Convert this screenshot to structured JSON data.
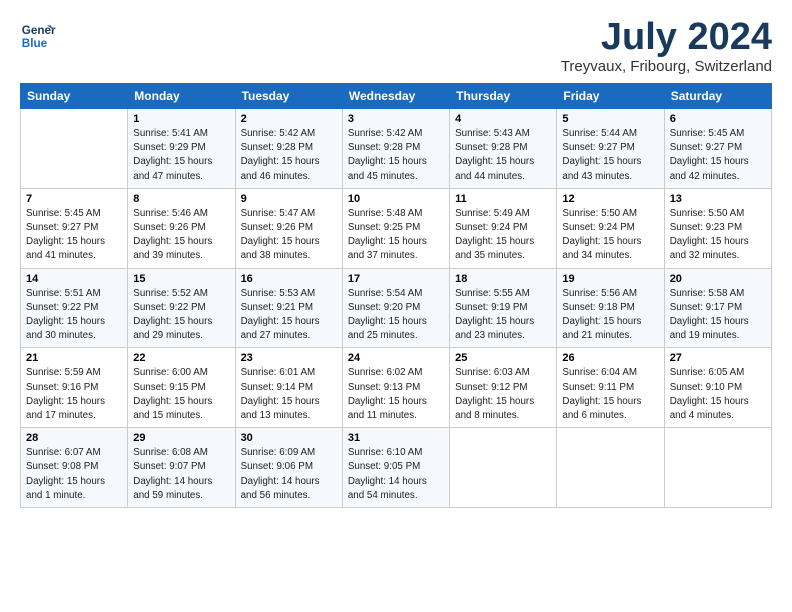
{
  "header": {
    "logo_line1": "General",
    "logo_line2": "Blue",
    "month": "July 2024",
    "location": "Treyvaux, Fribourg, Switzerland"
  },
  "weekdays": [
    "Sunday",
    "Monday",
    "Tuesday",
    "Wednesday",
    "Thursday",
    "Friday",
    "Saturday"
  ],
  "weeks": [
    [
      {
        "day": "",
        "content": ""
      },
      {
        "day": "1",
        "content": "Sunrise: 5:41 AM\nSunset: 9:29 PM\nDaylight: 15 hours\nand 47 minutes."
      },
      {
        "day": "2",
        "content": "Sunrise: 5:42 AM\nSunset: 9:28 PM\nDaylight: 15 hours\nand 46 minutes."
      },
      {
        "day": "3",
        "content": "Sunrise: 5:42 AM\nSunset: 9:28 PM\nDaylight: 15 hours\nand 45 minutes."
      },
      {
        "day": "4",
        "content": "Sunrise: 5:43 AM\nSunset: 9:28 PM\nDaylight: 15 hours\nand 44 minutes."
      },
      {
        "day": "5",
        "content": "Sunrise: 5:44 AM\nSunset: 9:27 PM\nDaylight: 15 hours\nand 43 minutes."
      },
      {
        "day": "6",
        "content": "Sunrise: 5:45 AM\nSunset: 9:27 PM\nDaylight: 15 hours\nand 42 minutes."
      }
    ],
    [
      {
        "day": "7",
        "content": "Sunrise: 5:45 AM\nSunset: 9:27 PM\nDaylight: 15 hours\nand 41 minutes."
      },
      {
        "day": "8",
        "content": "Sunrise: 5:46 AM\nSunset: 9:26 PM\nDaylight: 15 hours\nand 39 minutes."
      },
      {
        "day": "9",
        "content": "Sunrise: 5:47 AM\nSunset: 9:26 PM\nDaylight: 15 hours\nand 38 minutes."
      },
      {
        "day": "10",
        "content": "Sunrise: 5:48 AM\nSunset: 9:25 PM\nDaylight: 15 hours\nand 37 minutes."
      },
      {
        "day": "11",
        "content": "Sunrise: 5:49 AM\nSunset: 9:24 PM\nDaylight: 15 hours\nand 35 minutes."
      },
      {
        "day": "12",
        "content": "Sunrise: 5:50 AM\nSunset: 9:24 PM\nDaylight: 15 hours\nand 34 minutes."
      },
      {
        "day": "13",
        "content": "Sunrise: 5:50 AM\nSunset: 9:23 PM\nDaylight: 15 hours\nand 32 minutes."
      }
    ],
    [
      {
        "day": "14",
        "content": "Sunrise: 5:51 AM\nSunset: 9:22 PM\nDaylight: 15 hours\nand 30 minutes."
      },
      {
        "day": "15",
        "content": "Sunrise: 5:52 AM\nSunset: 9:22 PM\nDaylight: 15 hours\nand 29 minutes."
      },
      {
        "day": "16",
        "content": "Sunrise: 5:53 AM\nSunset: 9:21 PM\nDaylight: 15 hours\nand 27 minutes."
      },
      {
        "day": "17",
        "content": "Sunrise: 5:54 AM\nSunset: 9:20 PM\nDaylight: 15 hours\nand 25 minutes."
      },
      {
        "day": "18",
        "content": "Sunrise: 5:55 AM\nSunset: 9:19 PM\nDaylight: 15 hours\nand 23 minutes."
      },
      {
        "day": "19",
        "content": "Sunrise: 5:56 AM\nSunset: 9:18 PM\nDaylight: 15 hours\nand 21 minutes."
      },
      {
        "day": "20",
        "content": "Sunrise: 5:58 AM\nSunset: 9:17 PM\nDaylight: 15 hours\nand 19 minutes."
      }
    ],
    [
      {
        "day": "21",
        "content": "Sunrise: 5:59 AM\nSunset: 9:16 PM\nDaylight: 15 hours\nand 17 minutes."
      },
      {
        "day": "22",
        "content": "Sunrise: 6:00 AM\nSunset: 9:15 PM\nDaylight: 15 hours\nand 15 minutes."
      },
      {
        "day": "23",
        "content": "Sunrise: 6:01 AM\nSunset: 9:14 PM\nDaylight: 15 hours\nand 13 minutes."
      },
      {
        "day": "24",
        "content": "Sunrise: 6:02 AM\nSunset: 9:13 PM\nDaylight: 15 hours\nand 11 minutes."
      },
      {
        "day": "25",
        "content": "Sunrise: 6:03 AM\nSunset: 9:12 PM\nDaylight: 15 hours\nand 8 minutes."
      },
      {
        "day": "26",
        "content": "Sunrise: 6:04 AM\nSunset: 9:11 PM\nDaylight: 15 hours\nand 6 minutes."
      },
      {
        "day": "27",
        "content": "Sunrise: 6:05 AM\nSunset: 9:10 PM\nDaylight: 15 hours\nand 4 minutes."
      }
    ],
    [
      {
        "day": "28",
        "content": "Sunrise: 6:07 AM\nSunset: 9:08 PM\nDaylight: 15 hours\nand 1 minute."
      },
      {
        "day": "29",
        "content": "Sunrise: 6:08 AM\nSunset: 9:07 PM\nDaylight: 14 hours\nand 59 minutes."
      },
      {
        "day": "30",
        "content": "Sunrise: 6:09 AM\nSunset: 9:06 PM\nDaylight: 14 hours\nand 56 minutes."
      },
      {
        "day": "31",
        "content": "Sunrise: 6:10 AM\nSunset: 9:05 PM\nDaylight: 14 hours\nand 54 minutes."
      },
      {
        "day": "",
        "content": ""
      },
      {
        "day": "",
        "content": ""
      },
      {
        "day": "",
        "content": ""
      }
    ]
  ]
}
